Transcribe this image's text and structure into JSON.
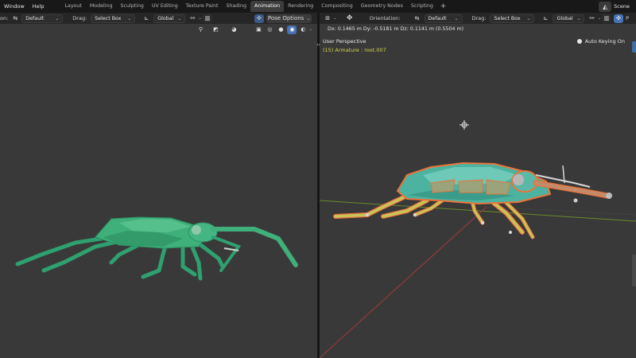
{
  "menubar": {
    "menus": [
      "Window",
      "Help"
    ],
    "tabs": [
      "Layout",
      "Modeling",
      "Sculpting",
      "UV Editing",
      "Texture Paint",
      "Shading",
      "Animation",
      "Rendering",
      "Compositing",
      "Geometry Nodes",
      "Scripting"
    ],
    "active_tab": "Animation",
    "add_tab": "+",
    "scene_label": "Scene"
  },
  "left_header": {
    "clipped_label": "on:",
    "keying_set": "Default",
    "drag_label": "Drag:",
    "drag_value": "Select Box",
    "transform_orientation": "Global",
    "pose_options": "Pose Options"
  },
  "right_header": {
    "orientation_label": "Orientation:",
    "orientation_value": "Default",
    "drag_label": "Drag:",
    "drag_value": "Select Box",
    "transform_orientation": "Global",
    "clipped_label": "P"
  },
  "right_viewport": {
    "delta_readout": "Dx: 0.1465 m   Dy: -0.5181 m   Dz: 0.1141 m (0.5504 m)",
    "view_name": "User Perspective",
    "active_object": "(15) Armature : root.007",
    "auto_keying": "Auto Keying On"
  },
  "colors": {
    "viewport_bg": "#393939",
    "mesh_green": "#3fb07a",
    "bone_yellow": "#c9c45a",
    "selected_outline": "#e8743b",
    "active_object_text": "#d8d84a",
    "x_axis": "#a33a3a",
    "y_axis": "#6a8a2a",
    "active_tab_bg": "#3d3d3d",
    "active_button": "#4772b3"
  },
  "icons": {
    "editor_type": "3d-viewport-icon",
    "transform": "move-icon",
    "pivot": "pivot-icon",
    "snap": "snap-icon",
    "proportional": "proportional-editing-icon",
    "gizmo": "gizmo-icon",
    "overlay": "overlay-icon",
    "xray": "xray-icon",
    "shading": [
      "wireframe-shading-icon",
      "solid-shading-icon",
      "material-preview-icon",
      "rendered-shading-icon"
    ],
    "scene": "scene-icon"
  }
}
